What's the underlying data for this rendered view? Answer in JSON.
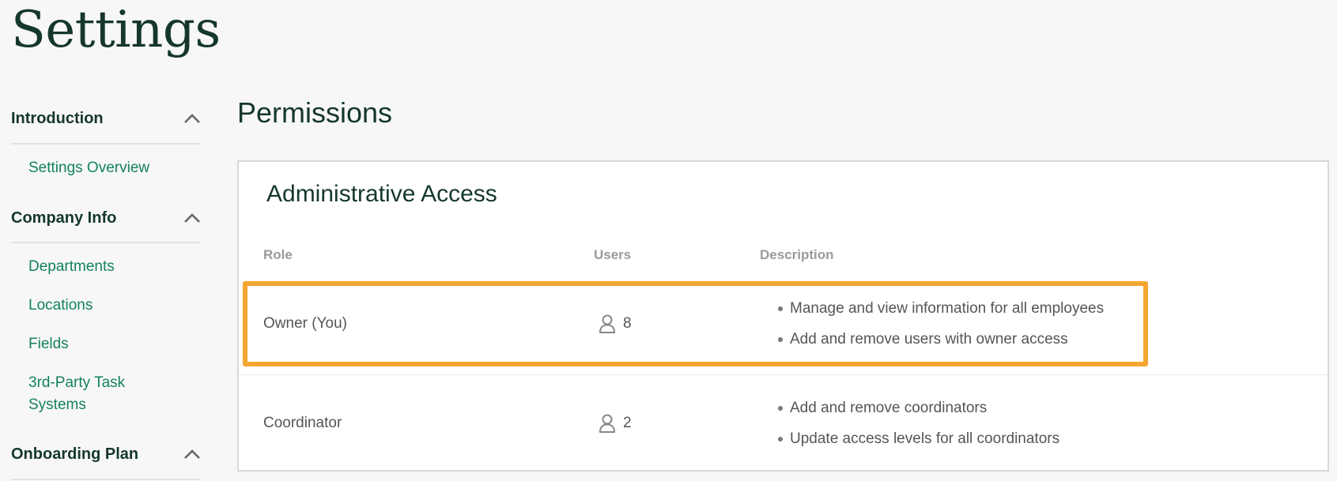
{
  "page": {
    "title": "Settings"
  },
  "sidebar": {
    "sections": [
      {
        "label": "Introduction",
        "expanded": true,
        "items": [
          {
            "label": "Settings Overview"
          }
        ]
      },
      {
        "label": "Company Info",
        "expanded": true,
        "items": [
          {
            "label": "Departments"
          },
          {
            "label": "Locations"
          },
          {
            "label": "Fields"
          },
          {
            "label": "3rd-Party Task Systems"
          }
        ]
      },
      {
        "label": "Onboarding Plan",
        "expanded": true,
        "items": []
      }
    ]
  },
  "main": {
    "section_title": "Permissions",
    "card": {
      "title": "Administrative Access",
      "columns": {
        "role": "Role",
        "users": "Users",
        "description": "Description"
      },
      "rows": [
        {
          "role": "Owner (You)",
          "users": "8",
          "description": [
            "Manage and view information for all employees",
            "Add and remove users with owner access"
          ],
          "highlighted": true
        },
        {
          "role": "Coordinator",
          "users": "2",
          "description": [
            "Add and remove coordinators",
            "Update access levels for all coordinators"
          ],
          "highlighted": false
        }
      ]
    }
  },
  "colors": {
    "brand_dark": "#15372c",
    "link_green": "#14825b",
    "highlight_orange": "#f5a631",
    "background": "#f7f7f7"
  },
  "icons": {
    "chevron": "chevron-up-icon",
    "users": "user-icon"
  }
}
